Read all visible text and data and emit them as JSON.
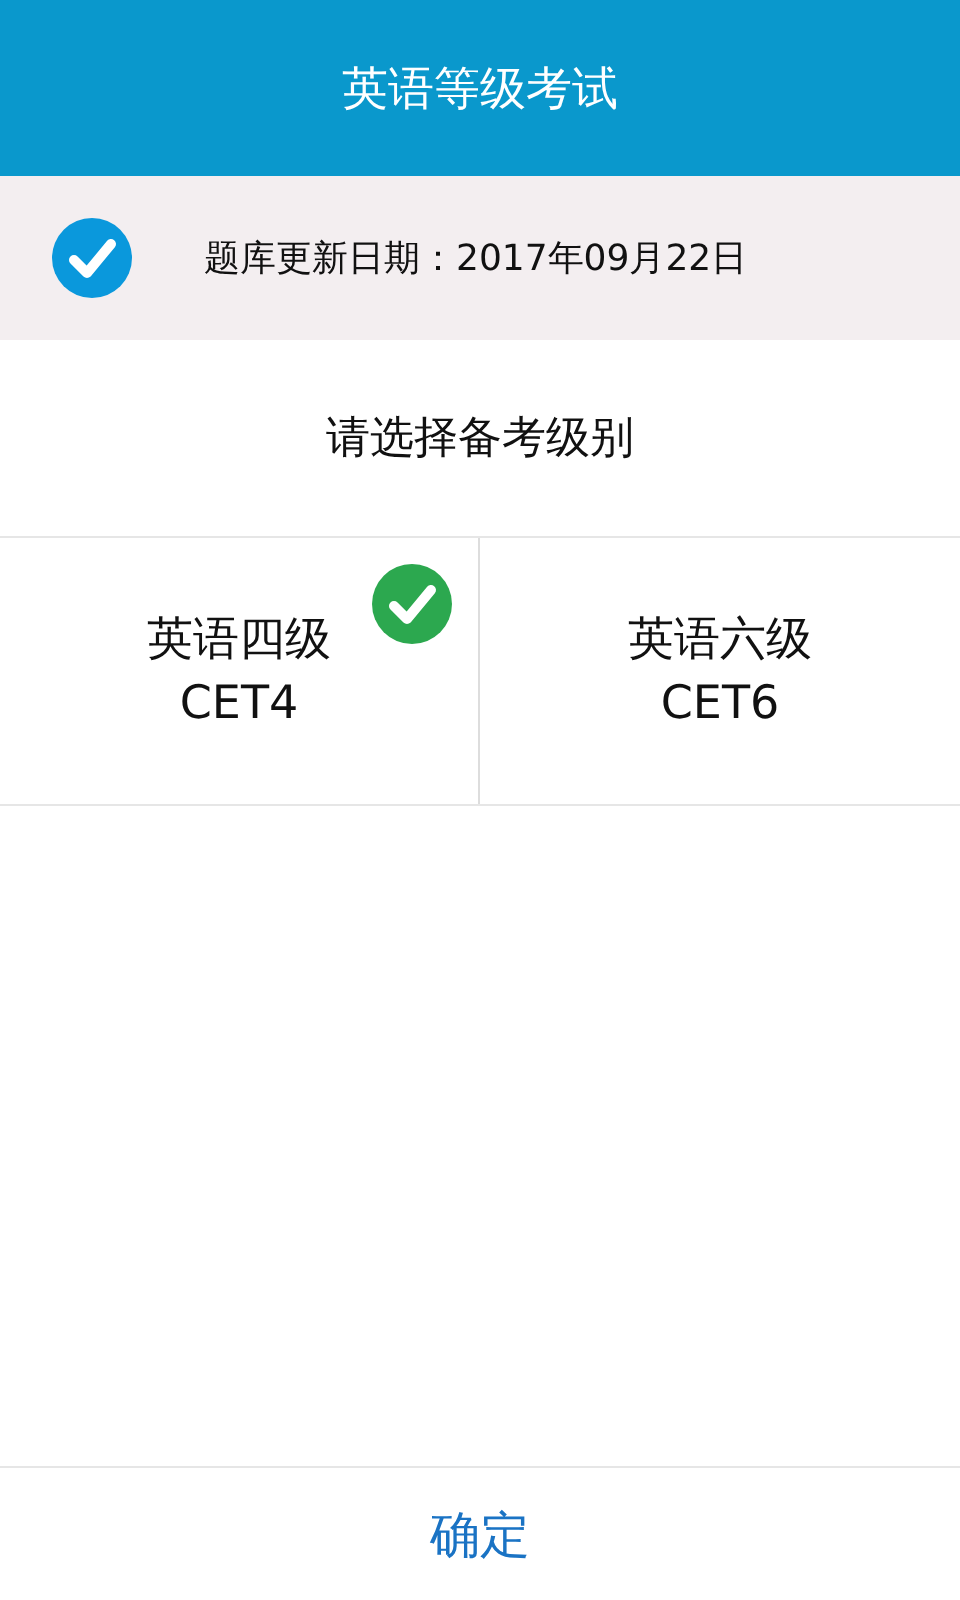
{
  "header": {
    "title": "英语等级考试"
  },
  "notice": {
    "text": "题库更新日期：2017年09月22日",
    "checked": true
  },
  "prompt": "请选择备考级别",
  "levels": [
    {
      "name": "英语四级",
      "code": "CET4",
      "selected": true
    },
    {
      "name": "英语六级",
      "code": "CET6",
      "selected": false
    }
  ],
  "confirm_button": "确定"
}
